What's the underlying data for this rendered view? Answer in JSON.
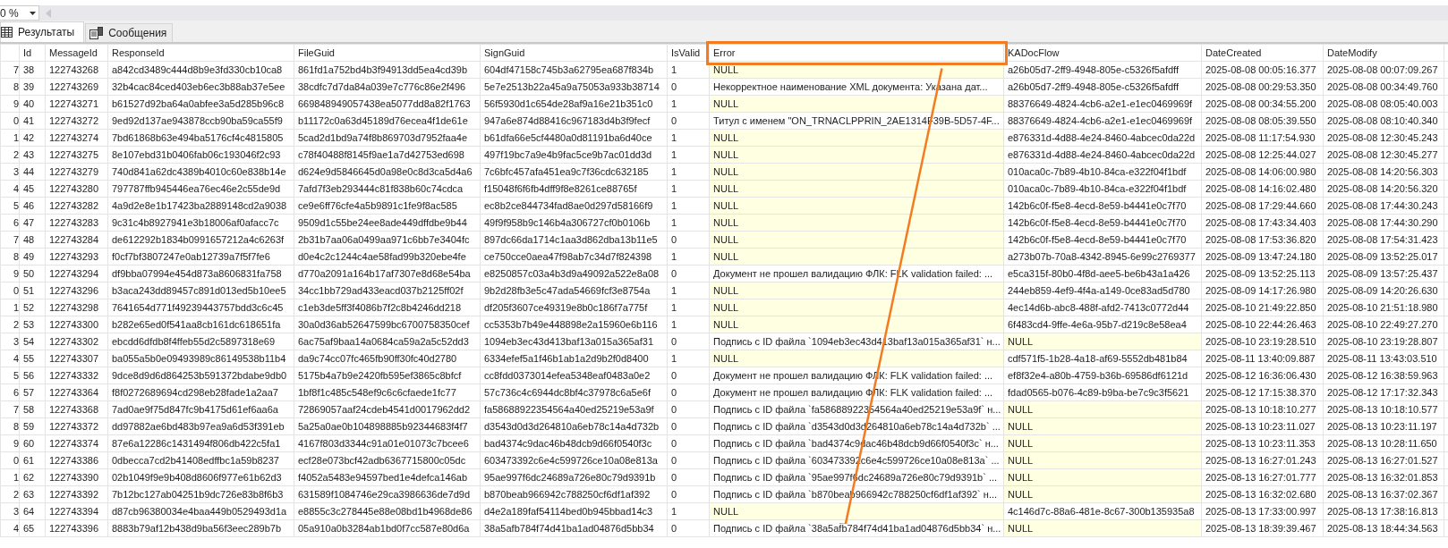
{
  "zoom": {
    "value": "0 %"
  },
  "tabs": [
    {
      "label": "Результаты",
      "kind": "grid",
      "selected": true
    },
    {
      "label": "Сообщения",
      "kind": "messages",
      "selected": false
    }
  ],
  "table": {
    "columns": [
      {
        "label": "Id",
        "highlighted": false
      },
      {
        "label": "MessageId",
        "highlighted": false
      },
      {
        "label": "ResponseId",
        "highlighted": false
      },
      {
        "label": "FileGuid",
        "highlighted": false
      },
      {
        "label": "SignGuid",
        "highlighted": false
      },
      {
        "label": "IsValid",
        "highlighted": false
      },
      {
        "label": "Error",
        "highlighted": true
      },
      {
        "label": "KADocFlow",
        "highlighted": false
      },
      {
        "label": "DateCreated",
        "highlighted": false
      },
      {
        "label": "DateModify",
        "highlighted": false
      }
    ],
    "rows": [
      {
        "row_number": "7",
        "cells": [
          "38",
          "122743268",
          "a842cd3489c444d8b9e3fd330cb10ca8",
          "861fd1a752bd4b3f94913dd5ea4cd39b",
          "604df47158c745b3a62795ea687f834b",
          "1",
          {
            "text": "NULL",
            "null": true
          },
          "a26b05d7-2ff9-4948-805e-c5326f5afdff",
          "2025-08-08 00:05:16.377",
          "2025-08-08 00:07:09.267"
        ]
      },
      {
        "row_number": "8",
        "cells": [
          "39",
          "122743269",
          "32b4cac84ced403eb6ec3b88ab37e5ee",
          "38cdfc7d7da84a039e7c776c86e2f496",
          "5e7e2513b22a45a9a75053a933b38714",
          "0",
          "Некорректное наименование XML документа: Указана дат...",
          "a26b05d7-2ff9-4948-805e-c5326f5afdff",
          "2025-08-08 00:29:53.350",
          "2025-08-08 00:34:49.760"
        ]
      },
      {
        "row_number": "9",
        "cells": [
          "40",
          "122743271",
          "b61527d92ba64a0abfee3a5d285b96c8",
          "669848949057438ea5077dd8a82f1763",
          "56f5930d1c654de28af9a16e21b351c0",
          "1",
          {
            "text": "NULL",
            "null": true
          },
          "88376649-4824-4cb6-a2e1-e1ec0469969f",
          "2025-08-08 00:34:55.200",
          "2025-08-08 08:05:40.003"
        ]
      },
      {
        "row_number": "0",
        "cells": [
          "41",
          "122743272",
          "9ed92d137ae943878ccb90ba59ca55f9",
          "b11172c0a63d45189d76ecea4f1de61e",
          "947a6e874d88416c967183d4b3f9fecf",
          "0",
          "Титул с именем \"ON_TRNACLPPRIN_2AE1314F39B-5D57-4F...",
          "88376649-4824-4cb6-a2e1-e1ec0469969f",
          "2025-08-08 08:05:39.550",
          "2025-08-08 08:10:40.340"
        ]
      },
      {
        "row_number": "1",
        "cells": [
          "42",
          "122743274",
          "7bd61868b63e494ba5176cf4c4815805",
          "5cad2d1bd9a74f8b869703d7952faa4e",
          "b61dfa66e5cf4480a0d81191ba6d40ce",
          "1",
          {
            "text": "NULL",
            "null": true
          },
          "e876331d-4d88-4e24-8460-4abcec0da22d",
          "2025-08-08 11:17:54.930",
          "2025-08-08 12:30:45.243"
        ]
      },
      {
        "row_number": "2",
        "cells": [
          "43",
          "122743275",
          "8e107ebd31b0406fab06c193046f2c93",
          "c78f40488f8145f9ae1a7d42753ed698",
          "497f19bc7a9e4b9fac5ce9b7ac01dd3d",
          "1",
          {
            "text": "NULL",
            "null": true
          },
          "e876331d-4d88-4e24-8460-4abcec0da22d",
          "2025-08-08 12:25:44.027",
          "2025-08-08 12:30:45.277"
        ]
      },
      {
        "row_number": "3",
        "cells": [
          "44",
          "122743279",
          "740d841a62dc4389b4010c60e838b14e",
          "d624e9d5846645d0a98e0c8d3ca5d4a6",
          "7c6bfc457afa451ea9c7f36cdc632185",
          "1",
          {
            "text": "NULL",
            "null": true
          },
          "010aca0c-7b89-4b10-84ca-e322f04f1bdf",
          "2025-08-08 14:06:00.980",
          "2025-08-08 14:20:56.303"
        ]
      },
      {
        "row_number": "4",
        "cells": [
          "45",
          "122743280",
          "797787ffb945446ea76ec46e2c55de9d",
          "7afd7f3eb293444c81f838b60c74cdca",
          "f15048f6f6fb4dff9f8e8261ce88765f",
          "1",
          {
            "text": "NULL",
            "null": true
          },
          "010aca0c-7b89-4b10-84ca-e322f04f1bdf",
          "2025-08-08 14:16:02.480",
          "2025-08-08 14:20:56.320"
        ]
      },
      {
        "row_number": "5",
        "cells": [
          "46",
          "122743282",
          "4a9d2e8e1b17423ba2889148cd2a9038",
          "ce9e6ff76cfe4a5b9891c1fe9f8ac585",
          "ec8b2ce844734fad8ae0d297d58166f9",
          "1",
          {
            "text": "NULL",
            "null": true
          },
          "142b6c0f-f5e8-4ecd-8e59-b4441e0c7f70",
          "2025-08-08 17:29:44.660",
          "2025-08-08 17:44:30.243"
        ]
      },
      {
        "row_number": "6",
        "cells": [
          "47",
          "122743283",
          "9c31c4b8927941e3b18006af0afacc7c",
          "9509d1c55be24ee8ade449dffdbe9b44",
          "49f9f958b9c146b4a306727cf0b0106b",
          "1",
          {
            "text": "NULL",
            "null": true
          },
          "142b6c0f-f5e8-4ecd-8e59-b4441e0c7f70",
          "2025-08-08 17:43:34.403",
          "2025-08-08 17:44:30.290"
        ]
      },
      {
        "row_number": "7",
        "cells": [
          "48",
          "122743284",
          "de612292b1834b0991657212a4c6263f",
          "2b31b7aa06a0499aa971c6bb7e3404fc",
          "897dc66da1714c1aa3d862dba13b11e5",
          "0",
          {
            "text": "NULL",
            "null": true
          },
          "142b6c0f-f5e8-4ecd-8e59-b4441e0c7f70",
          "2025-08-08 17:53:36.820",
          "2025-08-08 17:54:31.423"
        ]
      },
      {
        "row_number": "8",
        "cells": [
          "49",
          "122743293",
          "f0cf7bf3807247e0ab12739a7f5f7fe6",
          "d0e4c2c1244c4ae58fad99b320ebe4fe",
          "ce750cce0aea47f98ab7c34d7f824398",
          "1",
          {
            "text": "NULL",
            "null": true
          },
          "a273b07b-70a8-4342-8945-6e99c2769377",
          "2025-08-09 13:47:24.180",
          "2025-08-09 13:52:25.017"
        ]
      },
      {
        "row_number": "9",
        "cells": [
          "50",
          "122743294",
          "df9bba07994e454d873a8606831fa758",
          "d770a2091a164b17af7307e8d68e54ba",
          "e8250857c03a4b3d9a49092a522e8a08",
          "0",
          "Документ не прошел валидацию ФЛК: FLK validation failed: ...",
          "e5ca315f-80b0-4f8d-aee5-be6b43a1a426",
          "2025-08-09 13:52:25.113",
          "2025-08-09 13:57:25.437"
        ]
      },
      {
        "row_number": "0",
        "cells": [
          "51",
          "122743296",
          "b3aca243dd89457c891d013ed5b10ee5",
          "34cc1bb729ad433eacd037b2125ff02f",
          "9b2d28fb3e5c47ada54669fcf3e8754a",
          "1",
          {
            "text": "NULL",
            "null": true
          },
          "244eb859-4ef9-4f4a-a149-0ce83ad5d780",
          "2025-08-09 14:17:26.980",
          "2025-08-09 14:20:26.630"
        ]
      },
      {
        "row_number": "1",
        "cells": [
          "52",
          "122743298",
          "7641654d771f49239443757bdd3c6c45",
          "c1eb3de5ff3f4086b7f2c8b4246dd218",
          "df205f3607ce49319e8b0c186f7a775f",
          "1",
          {
            "text": "NULL",
            "null": true
          },
          "4ec14d6b-abc8-488f-afd2-7413c0772d44",
          "2025-08-10 21:49:22.850",
          "2025-08-10 21:51:18.980"
        ]
      },
      {
        "row_number": "2",
        "cells": [
          "53",
          "122743300",
          "b282e65ed0f541aa8cb161dc618651fa",
          "30a0d36ab52647599bc6700758350cef",
          "cc5353b7b49e448898e2a15960e6b116",
          "1",
          {
            "text": "NULL",
            "null": true
          },
          "6f483cd4-9ffe-4e6a-95b7-d219c8e58ea4",
          "2025-08-10 22:44:26.463",
          "2025-08-10 22:49:27.270"
        ]
      },
      {
        "row_number": "3",
        "cells": [
          "54",
          "122743302",
          "ebcdd6dfdb8f4ffeb55d2c5897318e69",
          "6ac75af9baa14a0684ca59a2a5c52dd3",
          "1094eb3ec43d413baf13a015a365af31",
          "0",
          "Подпись с ID файла `1094eb3ec43d413baf13a015a365af31` н...",
          {
            "text": "NULL",
            "null": true
          },
          "2025-08-10 23:19:28.510",
          "2025-08-10 23:19:28.807"
        ]
      },
      {
        "row_number": "4",
        "cells": [
          "55",
          "122743307",
          "ba055a5b0e09493989c86149538b11b4",
          "da9c74cc07fc465fb90ff30fc40d2780",
          "6334efef5a1f46b1ab1a2d9b2f0d8400",
          "1",
          {
            "text": "NULL",
            "null": true
          },
          "cdf571f5-1b28-4a18-af69-5552db481b84",
          "2025-08-11 13:40:09.887",
          "2025-08-11 13:43:03.510"
        ]
      },
      {
        "row_number": "5",
        "cells": [
          "56",
          "122743332",
          "9dce8d9d6d864253b591372bdabe9db0",
          "5175b4a7b9e2420fb595ef3865c8bfcf",
          "cc8fdd0373014efea5348eaf0483a0e2",
          "0",
          "Документ не прошел валидацию ФЛК: FLK validation failed: ...",
          "ef8f32e4-a80b-4759-b36b-69586df6121d",
          "2025-08-12 16:36:06.430",
          "2025-08-12 16:38:59.963"
        ]
      },
      {
        "row_number": "6",
        "cells": [
          "57",
          "122743364",
          "f8f0272689694cd298eb28fade1a2aa7",
          "1bf8f1c485c548ef9c6c6cfaede1fc77",
          "57c736c4c6944dc8bf4c37978c6a5e6f",
          "0",
          "Документ не прошел валидацию ФЛК: FLK validation failed: ...",
          "fdad0565-b076-4c89-b9ba-be7c9c3f5621",
          "2025-08-12 17:15:38.370",
          "2025-08-12 17:17:32.343"
        ]
      },
      {
        "row_number": "7",
        "cells": [
          "58",
          "122743368",
          "7ad0ae9f75d847fc9b4175d61ef6aa6a",
          "72869057aaf24cdeb4541d0017962dd2",
          "fa58688922354564a40ed25219e53a9f",
          "0",
          "Подпись с ID файла `fa58688922354564a40ed25219e53a9f` н...",
          {
            "text": "NULL",
            "null": true
          },
          "2025-08-13 10:18:10.277",
          "2025-08-13 10:18:10.577"
        ]
      },
      {
        "row_number": "8",
        "cells": [
          "59",
          "122743372",
          "dd97882ae6bd483b97ea9a6d53f391eb",
          "5a25a0ae0b104898885b92344683f4f7",
          "d3543d0d3d264810a6eb78c14a4d732b",
          "0",
          "Подпись с ID файла `d3543d0d3d264810a6eb78c14a4d732b` ...",
          {
            "text": "NULL",
            "null": true
          },
          "2025-08-13 10:23:11.027",
          "2025-08-13 10:23:11.197"
        ]
      },
      {
        "row_number": "9",
        "cells": [
          "60",
          "122743374",
          "87e6a12286c1431494f806db422c5fa1",
          "4167f803d3344c91a01e01073c7bcee6",
          "bad4374c9dac46b48dcb9d66f0540f3c",
          "0",
          "Подпись с ID файла `bad4374c9dac46b48dcb9d66f0540f3c` н...",
          {
            "text": "NULL",
            "null": true
          },
          "2025-08-13 10:23:11.353",
          "2025-08-13 10:28:11.650"
        ]
      },
      {
        "row_number": "0",
        "cells": [
          "61",
          "122743386",
          "0dbecca7cd2b41408edffbc1a59b8237",
          "ecf28e073bcf42adb6367715800c05dc",
          "603473392c6e4c599726ce10a08e813a",
          "0",
          "Подпись с ID файла `603473392c6e4c599726ce10a08e813a` ...",
          {
            "text": "NULL",
            "null": true
          },
          "2025-08-13 16:27:01.243",
          "2025-08-13 16:27:01.527"
        ]
      },
      {
        "row_number": "1",
        "cells": [
          "62",
          "122743390",
          "02b1049f9e9b408d8606f977e61b62d3",
          "f4052a5483e94597bed1e4defca146ab",
          "95ae997f6dc24689a726e80c79d9391b",
          "0",
          "Подпись с ID файла `95ae997f6dc24689a726e80c79d9391b` ...",
          {
            "text": "NULL",
            "null": true
          },
          "2025-08-13 16:27:01.777",
          "2025-08-13 16:32:01.853"
        ]
      },
      {
        "row_number": "2",
        "cells": [
          "63",
          "122743392",
          "7b12bc127ab04251b9dc726e83b8f6b3",
          "631589f1084746e29ca3986636de7d9d",
          "b870beab966942c788250cf6df1af392",
          "0",
          "Подпись с ID файла `b870beab966942c788250cf6df1af392` н...",
          {
            "text": "NULL",
            "null": true
          },
          "2025-08-13 16:32:02.680",
          "2025-08-13 16:37:02.367"
        ]
      },
      {
        "row_number": "3",
        "cells": [
          "64",
          "122743394",
          "d87cb96380034e4baa449b0529493d1a",
          "e8855c3c278445e88e08bd1b4968de86",
          "d4e2a189faf54114bed0b945bbad14c3",
          "1",
          {
            "text": "NULL",
            "null": true
          },
          "4c146d7c-88a6-481e-8c67-300b135935a8",
          "2025-08-13 17:33:00.997",
          "2025-08-13 17:38:16.813"
        ]
      },
      {
        "row_number": "4",
        "cells": [
          "65",
          "122743396",
          "8883b79af12b438d9ba56f3eec289b7b",
          "05a910a0b3284ab1bd0f7cc587e80d6a",
          "38a5afb784f74d41ba1ad04876d5bb34",
          "0",
          "Подпись с ID файла `38a5afb784f74d41ba1ad04876d5bb34` н...",
          {
            "text": "NULL",
            "null": true
          },
          "2025-08-13 18:39:39.467",
          "2025-08-13 18:44:34.563"
        ]
      }
    ]
  }
}
